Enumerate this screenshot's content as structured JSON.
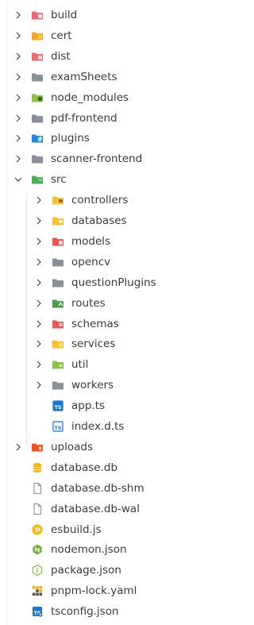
{
  "items": [
    {
      "label": "build",
      "depth": 0,
      "kind": "folder",
      "state": "collapsed",
      "color": "#e86a72",
      "badge": "build"
    },
    {
      "label": "cert",
      "depth": 0,
      "kind": "folder",
      "state": "collapsed",
      "color": "#f5a623",
      "badge": "cert"
    },
    {
      "label": "dist",
      "depth": 0,
      "kind": "folder",
      "state": "collapsed",
      "color": "#e86a72",
      "badge": "dist"
    },
    {
      "label": "examSheets",
      "depth": 0,
      "kind": "folder",
      "state": "collapsed",
      "color": "#8a8f98",
      "badge": "plain"
    },
    {
      "label": "node_modules",
      "depth": 0,
      "kind": "folder",
      "state": "collapsed",
      "color": "#8bc34a",
      "badge": "node"
    },
    {
      "label": "pdf-frontend",
      "depth": 0,
      "kind": "folder",
      "state": "collapsed",
      "color": "#8a8f98",
      "badge": "plain"
    },
    {
      "label": "plugins",
      "depth": 0,
      "kind": "folder",
      "state": "collapsed",
      "color": "#1e88e5",
      "badge": "plugins"
    },
    {
      "label": "scanner-frontend",
      "depth": 0,
      "kind": "folder",
      "state": "collapsed",
      "color": "#8a8f98",
      "badge": "plain"
    },
    {
      "label": "src",
      "depth": 0,
      "kind": "folder",
      "state": "expanded",
      "color": "#4caf50",
      "badge": "src"
    },
    {
      "label": "controllers",
      "depth": 1,
      "kind": "folder",
      "state": "collapsed",
      "color": "#fbc02d",
      "badge": "controllers"
    },
    {
      "label": "databases",
      "depth": 1,
      "kind": "folder",
      "state": "collapsed",
      "color": "#fbc02d",
      "badge": "databases"
    },
    {
      "label": "models",
      "depth": 1,
      "kind": "folder",
      "state": "collapsed",
      "color": "#ef5350",
      "badge": "models"
    },
    {
      "label": "opencv",
      "depth": 1,
      "kind": "folder",
      "state": "collapsed",
      "color": "#8a8f98",
      "badge": "plain"
    },
    {
      "label": "questionPlugins",
      "depth": 1,
      "kind": "folder",
      "state": "collapsed",
      "color": "#8a8f98",
      "badge": "plain"
    },
    {
      "label": "routes",
      "depth": 1,
      "kind": "folder",
      "state": "collapsed",
      "color": "#43a047",
      "badge": "routes"
    },
    {
      "label": "schemas",
      "depth": 1,
      "kind": "folder",
      "state": "collapsed",
      "color": "#ef5350",
      "badge": "schemas"
    },
    {
      "label": "services",
      "depth": 1,
      "kind": "folder",
      "state": "collapsed",
      "color": "#fbc02d",
      "badge": "services"
    },
    {
      "label": "util",
      "depth": 1,
      "kind": "folder",
      "state": "collapsed",
      "color": "#8bc34a",
      "badge": "util"
    },
    {
      "label": "workers",
      "depth": 1,
      "kind": "folder",
      "state": "collapsed",
      "color": "#8a8f98",
      "badge": "plain"
    },
    {
      "label": "app.ts",
      "depth": 1,
      "kind": "file",
      "icon": "ts",
      "icon_text": "TS",
      "color": "#1976d2"
    },
    {
      "label": "index.d.ts",
      "depth": 1,
      "kind": "file",
      "icon": "dts",
      "icon_text": "TS",
      "color": "#1976d2"
    },
    {
      "label": "uploads",
      "depth": 0,
      "kind": "folder",
      "state": "collapsed",
      "color": "#f4511e",
      "badge": "uploads"
    },
    {
      "label": "database.db",
      "depth": 0,
      "kind": "file",
      "icon": "db",
      "color": "#f5b400"
    },
    {
      "label": "database.db-shm",
      "depth": 0,
      "kind": "file",
      "icon": "doc",
      "color": "#8a8f98"
    },
    {
      "label": "database.db-wal",
      "depth": 0,
      "kind": "file",
      "icon": "doc",
      "color": "#8a8f98"
    },
    {
      "label": "esbuild.js",
      "depth": 0,
      "kind": "file",
      "icon": "esbuild",
      "color": "#ffb300"
    },
    {
      "label": "nodemon.json",
      "depth": 0,
      "kind": "file",
      "icon": "nodemon",
      "color": "#76b041"
    },
    {
      "label": "package.json",
      "depth": 0,
      "kind": "file",
      "icon": "package",
      "color": "#8bc34a"
    },
    {
      "label": "pnpm-lock.yaml",
      "depth": 0,
      "kind": "file",
      "icon": "pnpm",
      "color": "#f9ad00"
    },
    {
      "label": "tsconfig.json",
      "depth": 0,
      "kind": "file",
      "icon": "tsconfig",
      "icon_text": "TS",
      "color": "#1976d2"
    }
  ]
}
